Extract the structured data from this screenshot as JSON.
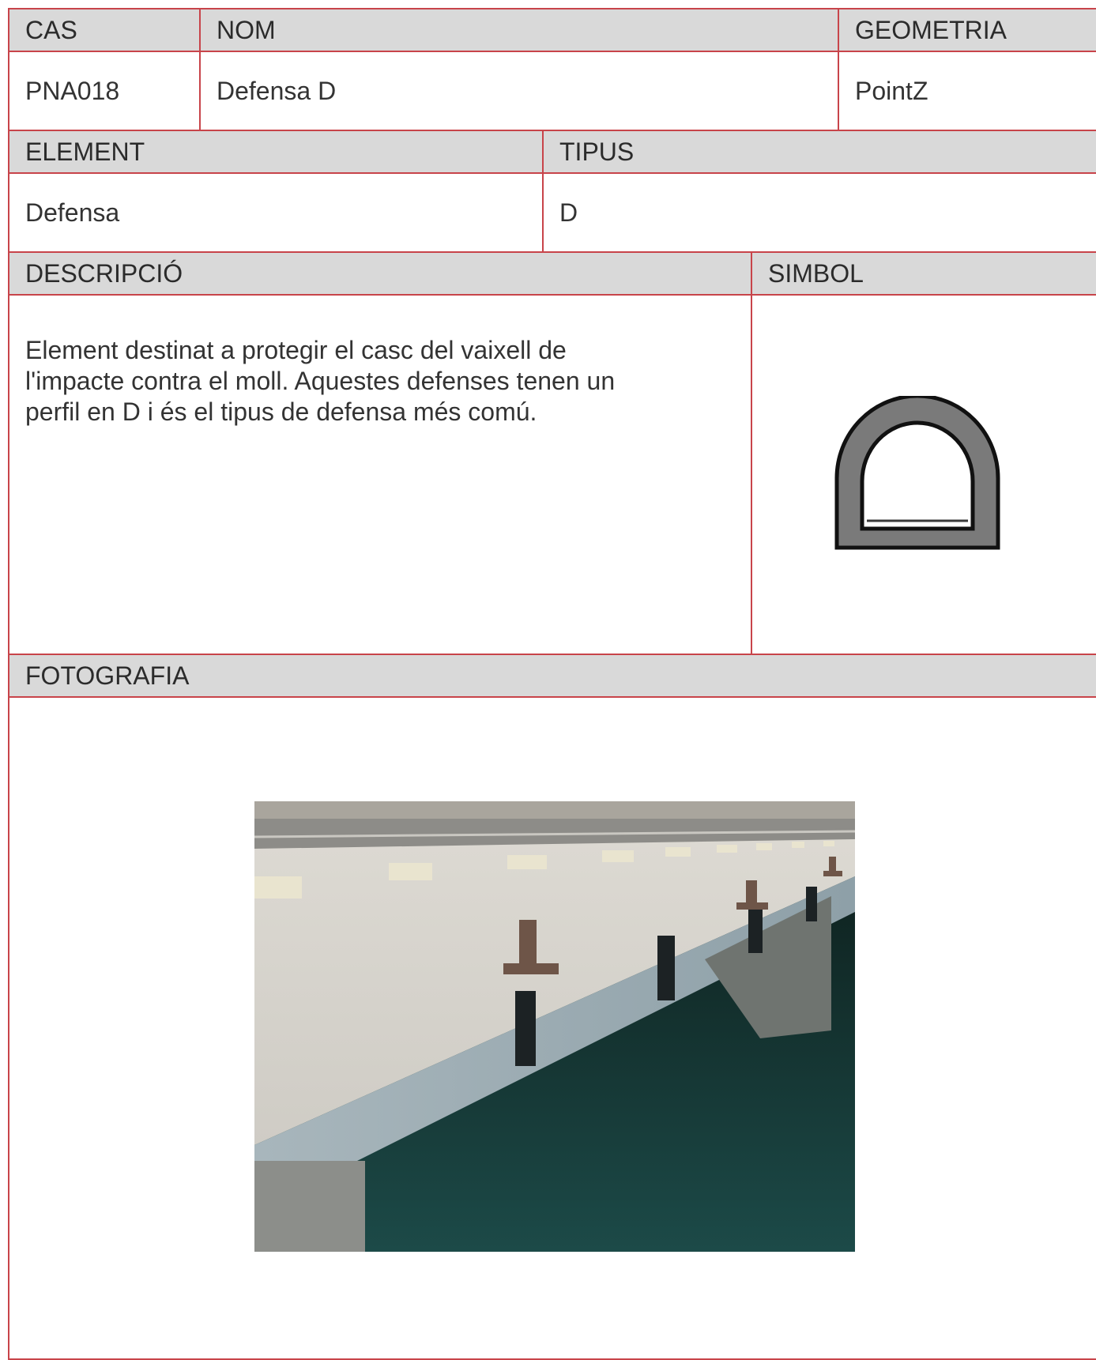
{
  "cas": {
    "label": "CAS",
    "value": "PNA018"
  },
  "nom": {
    "label": "NOM",
    "value": "Defensa D"
  },
  "geometria": {
    "label": "GEOMETRIA",
    "value": "PointZ"
  },
  "element": {
    "label": "ELEMENT",
    "value": "Defensa"
  },
  "tipus": {
    "label": "TIPUS",
    "value": "D"
  },
  "descripcio": {
    "label": "DESCRIPCIÓ",
    "lines": [
      "Element destinat a protegir el casc del vaixell de",
      "l'impacte contra el moll. Aquestes defenses tenen un",
      "perfil en D i és el tipus de defensa més comú."
    ]
  },
  "simbol": {
    "label": "SIMBOL",
    "icon": "d-fender-profile-icon"
  },
  "fotografia": {
    "label": "FOTOGRAFIA",
    "image": "quay-with-bollards-and-d-fenders-photo"
  },
  "colors": {
    "border": "#c8444a",
    "header_bg": "#d9d9d9",
    "text": "#333333"
  }
}
